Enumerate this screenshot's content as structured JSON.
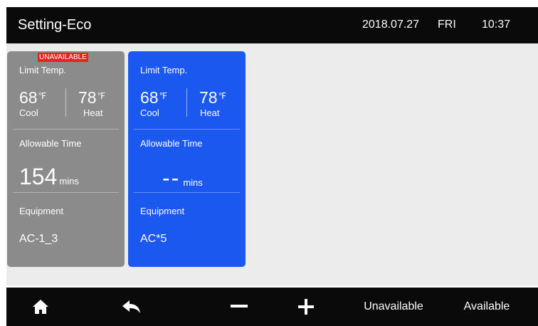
{
  "header": {
    "title": "Setting-Eco",
    "date": "2018.07.27",
    "day": "FRI",
    "time": "10:37"
  },
  "cards": [
    {
      "badge": "UNAVAILABLE",
      "limit_label": "Limit Temp.",
      "cool_value": "68",
      "heat_value": "78",
      "unit": "℉",
      "cool_label": "Cool",
      "heat_label": "Heat",
      "time_label": "Allowable Time",
      "time_value": "154",
      "time_unit": "mins",
      "equipment_label": "Equipment",
      "equipment_value": "AC-1_3",
      "color": "#8b8b8b"
    },
    {
      "limit_label": "Limit Temp.",
      "cool_value": "68",
      "heat_value": "78",
      "unit": "℉",
      "cool_label": "Cool",
      "heat_label": "Heat",
      "time_label": "Allowable Time",
      "time_value": "--",
      "time_unit": "mins",
      "equipment_label": "Equipment",
      "equipment_value": "AC*5",
      "color": "#1a58f0"
    }
  ],
  "footer": {
    "home_icon": "home-icon",
    "back_icon": "back-arrow-icon",
    "minus_icon": "minus-icon",
    "plus_icon": "plus-icon",
    "unavailable_label": "Unavailable",
    "available_label": "Available"
  }
}
